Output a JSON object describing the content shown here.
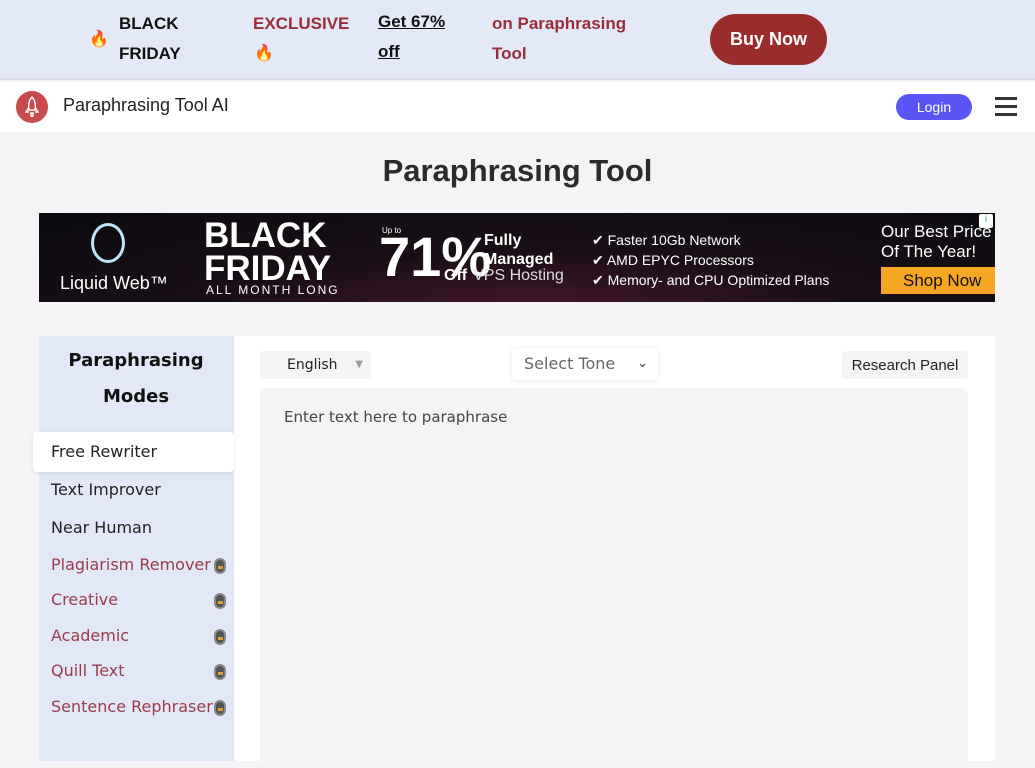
{
  "promo": {
    "fire_icon": "fire-emoji",
    "black_friday": "BLACK FRIDAY",
    "exclusive": "EXCLUSIVE",
    "get_off": "Get 67% off",
    "on_tool": "on Paraphrasing Tool",
    "buy_now": "Buy Now",
    "colors": {
      "bg": "#e4e9f7",
      "accent": "#9b2c2c"
    }
  },
  "header": {
    "brand": "Paraphrasing Tool AI",
    "login": "Login",
    "menu_icon": "hamburger-icon",
    "login_color": "#5a55f5"
  },
  "page_title": "Paraphrasing Tool",
  "ad": {
    "brand": "Liquid Web™",
    "headline1": "BLACK",
    "headline2": "FRIDAY",
    "sub": "ALL MONTH LONG",
    "upto": "Up to",
    "percent": "71%",
    "off": "Off",
    "fully": "Fully",
    "managed": "Managed",
    "vps": "VPS Hosting",
    "features": [
      "✔ Faster 10Gb Network",
      "✔ AMD EPYC Processors",
      "✔ Memory- and CPU Optimized Plans"
    ],
    "best1": "Our Best Price",
    "best2": "Of The Year!",
    "shop": "Shop Now"
  },
  "sidebar": {
    "title": "Paraphrasing Modes",
    "items": [
      {
        "label": "Free Rewriter",
        "active": true,
        "locked": false
      },
      {
        "label": "Text Improver",
        "locked": false
      },
      {
        "label": "Near Human",
        "locked": false
      },
      {
        "label": "Plagiarism Remover",
        "locked": true
      },
      {
        "label": "Creative",
        "locked": true
      },
      {
        "label": "Academic",
        "locked": true
      },
      {
        "label": "Quill Text",
        "locked": true
      },
      {
        "label": "Sentence Rephraser",
        "locked": true
      }
    ]
  },
  "toolbar": {
    "language": "English",
    "tone_placeholder": "Select Tone",
    "research_panel": "Research Panel"
  },
  "editor": {
    "placeholder": "Enter text here to paraphrase",
    "value": ""
  }
}
